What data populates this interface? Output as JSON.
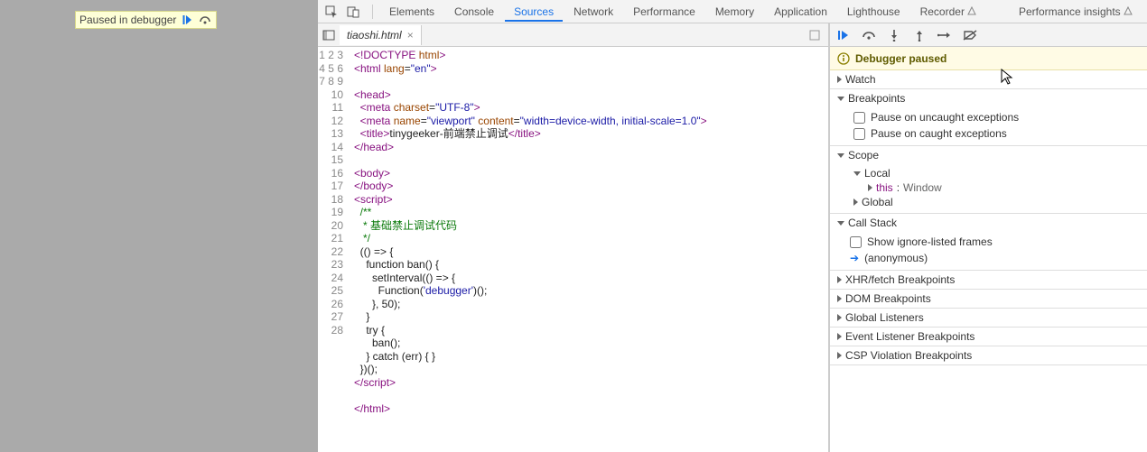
{
  "banner": {
    "text": "Paused in debugger"
  },
  "tabs": {
    "elements": "Elements",
    "console": "Console",
    "sources": "Sources",
    "network": "Network",
    "performance": "Performance",
    "memory": "Memory",
    "application": "Application",
    "lighthouse": "Lighthouse",
    "recorder": "Recorder",
    "perfInsights": "Performance insights"
  },
  "file": {
    "name": "tiaoshi.html"
  },
  "gutter": "1\n2\n3\n4\n5\n6\n7\n8\n9\n10\n11\n12\n13\n14\n15\n16\n17\n18\n19\n20\n21\n22\n23\n24\n25\n26\n27\n28",
  "code": {
    "l1a": "<!DOCTYPE ",
    "l1b": "html",
    "l1c": ">",
    "l2a": "<html ",
    "l2b": "lang",
    "l2c": "=",
    "l2d": "\"en\"",
    "l2e": ">",
    "l3": "",
    "l4a": "<head>",
    "l5a": "  <meta ",
    "l5b": "charset",
    "l5c": "=",
    "l5d": "\"UTF-8\"",
    "l5e": ">",
    "l6a": "  <meta ",
    "l6b": "name",
    "l6c": "=",
    "l6d": "\"viewport\"",
    "l6e": " ",
    "l6f": "content",
    "l6g": "=",
    "l6h": "\"width=device-width, initial-scale=1.0\"",
    "l6i": ">",
    "l7a": "  <title>",
    "l7b": "tinygeeker-前端禁止调试",
    "l7c": "</title>",
    "l8a": "</head>",
    "l9": "",
    "l10a": "<body>",
    "l11a": "</body>",
    "l12a": "<script>",
    "l13a": "  /**",
    "l14a": "   * 基础禁止调试代码",
    "l15a": "   */",
    "l16a": "  (() => {",
    "l17a": "    function ban() {",
    "l18a": "      setInterval(() => {",
    "l19a": "        Function(",
    "l19b": "'debugger'",
    "l19c": ")();",
    "l20a": "      }, 50);",
    "l21a": "    }",
    "l22a": "    try {",
    "l23a": "      ban();",
    "l24a": "    } catch (err) { }",
    "l25a": "  })();",
    "l26a": "</scrip",
    "l26b": "t>",
    "l27": "",
    "l28a": "</html>"
  },
  "dbg": {
    "status": "Debugger paused",
    "watch": {
      "label": "Watch"
    },
    "breakpoints": {
      "label": "Breakpoints",
      "uncaught": "Pause on uncaught exceptions",
      "caught": "Pause on caught exceptions"
    },
    "scope": {
      "label": "Scope",
      "local": "Local",
      "this_k": "this",
      "this_sep": ": ",
      "this_v": "Window",
      "global": "Global"
    },
    "callstack": {
      "label": "Call Stack",
      "ignore": "Show ignore-listed frames",
      "frame0": "(anonymous)"
    },
    "xhr": "XHR/fetch Breakpoints",
    "dom": "DOM Breakpoints",
    "glis": "Global Listeners",
    "evl": "Event Listener Breakpoints",
    "csp": "CSP Violation Breakpoints"
  }
}
